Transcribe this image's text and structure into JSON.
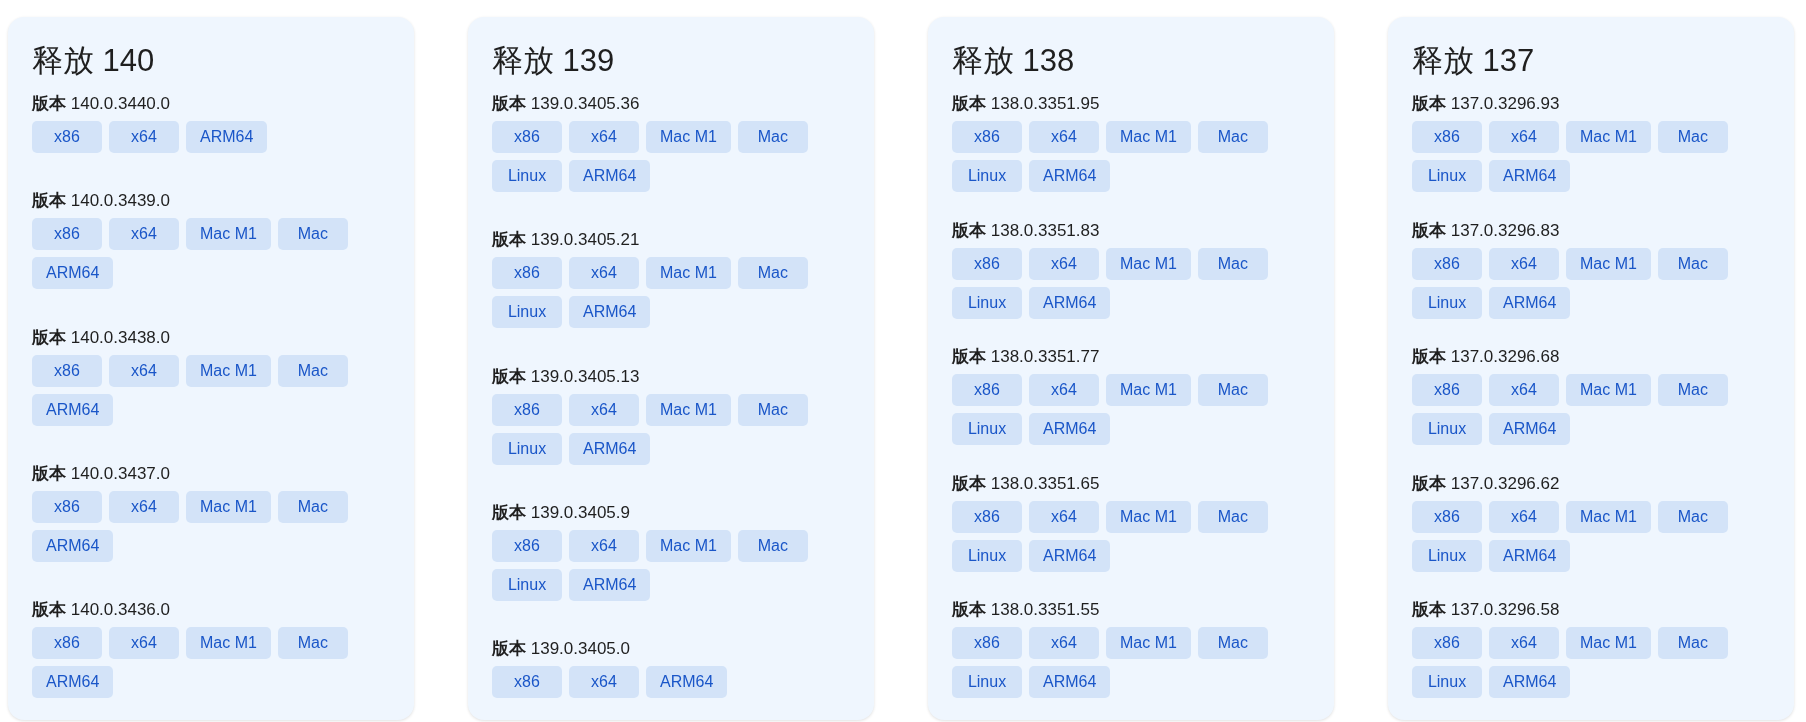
{
  "releases": [
    {
      "title": "释放 140",
      "versions": [
        {
          "text": "**版本** 140.0.3440.0",
          "platforms": [
            "x86",
            "x64",
            "ARM64"
          ]
        },
        {
          "text": "**版本** 140.0.3439.0",
          "platforms": [
            "x86",
            "x64",
            "Mac M1",
            "Mac",
            "ARM64"
          ]
        },
        {
          "text": "**版本** 140.0.3438.0",
          "platforms": [
            "x86",
            "x64",
            "Mac M1",
            "Mac",
            "ARM64"
          ]
        },
        {
          "text": "**版本** 140.0.3437.0",
          "platforms": [
            "x86",
            "x64",
            "Mac M1",
            "Mac",
            "ARM64"
          ]
        },
        {
          "text": "**版本** 140.0.3436.0",
          "platforms": [
            "x86",
            "x64",
            "Mac M1",
            "Mac",
            "ARM64"
          ]
        }
      ]
    },
    {
      "title": "释放 139",
      "versions": [
        {
          "text": "**版本** 139.0.3405.36",
          "platforms": [
            "x86",
            "x64",
            "Mac M1",
            "Mac",
            "Linux",
            "ARM64"
          ]
        },
        {
          "text": "**版本** 139.0.3405.21",
          "platforms": [
            "x86",
            "x64",
            "Mac M1",
            "Mac",
            "Linux",
            "ARM64"
          ]
        },
        {
          "text": "**版本** 139.0.3405.13",
          "platforms": [
            "x86",
            "x64",
            "Mac M1",
            "Mac",
            "Linux",
            "ARM64"
          ]
        },
        {
          "text": "**版本** 139.0.3405.9",
          "platforms": [
            "x86",
            "x64",
            "Mac M1",
            "Mac",
            "Linux",
            "ARM64"
          ]
        },
        {
          "text": "**版本** 139.0.3405.0",
          "platforms": [
            "x86",
            "x64",
            "ARM64"
          ]
        }
      ]
    },
    {
      "title": "释放 138",
      "versions": [
        {
          "text": "**版本** 138.0.3351.95",
          "platforms": [
            "x86",
            "x64",
            "Mac M1",
            "Mac",
            "Linux",
            "ARM64"
          ]
        },
        {
          "text": "**版本** 138.0.3351.83",
          "platforms": [
            "x86",
            "x64",
            "Mac M1",
            "Mac",
            "Linux",
            "ARM64"
          ]
        },
        {
          "text": "**版本** 138.0.3351.77",
          "platforms": [
            "x86",
            "x64",
            "Mac M1",
            "Mac",
            "Linux",
            "ARM64"
          ]
        },
        {
          "text": "**版本** 138.0.3351.65",
          "platforms": [
            "x86",
            "x64",
            "Mac M1",
            "Mac",
            "Linux",
            "ARM64"
          ]
        },
        {
          "text": "**版本** 138.0.3351.55",
          "platforms": [
            "x86",
            "x64",
            "Mac M1",
            "Mac",
            "Linux",
            "ARM64"
          ]
        }
      ]
    },
    {
      "title": "释放 137",
      "versions": [
        {
          "text": "**版本** 137.0.3296.93",
          "platforms": [
            "x86",
            "x64",
            "Mac M1",
            "Mac",
            "Linux",
            "ARM64"
          ]
        },
        {
          "text": "**版本** 137.0.3296.83",
          "platforms": [
            "x86",
            "x64",
            "Mac M1",
            "Mac",
            "Linux",
            "ARM64"
          ]
        },
        {
          "text": "**版本** 137.0.3296.68",
          "platforms": [
            "x86",
            "x64",
            "Mac M1",
            "Mac",
            "Linux",
            "ARM64"
          ]
        },
        {
          "text": "**版本** 137.0.3296.62",
          "platforms": [
            "x86",
            "x64",
            "Mac M1",
            "Mac",
            "Linux",
            "ARM64"
          ]
        },
        {
          "text": "**版本** 137.0.3296.58",
          "platforms": [
            "x86",
            "x64",
            "Mac M1",
            "Mac",
            "Linux",
            "ARM64"
          ]
        }
      ]
    }
  ]
}
